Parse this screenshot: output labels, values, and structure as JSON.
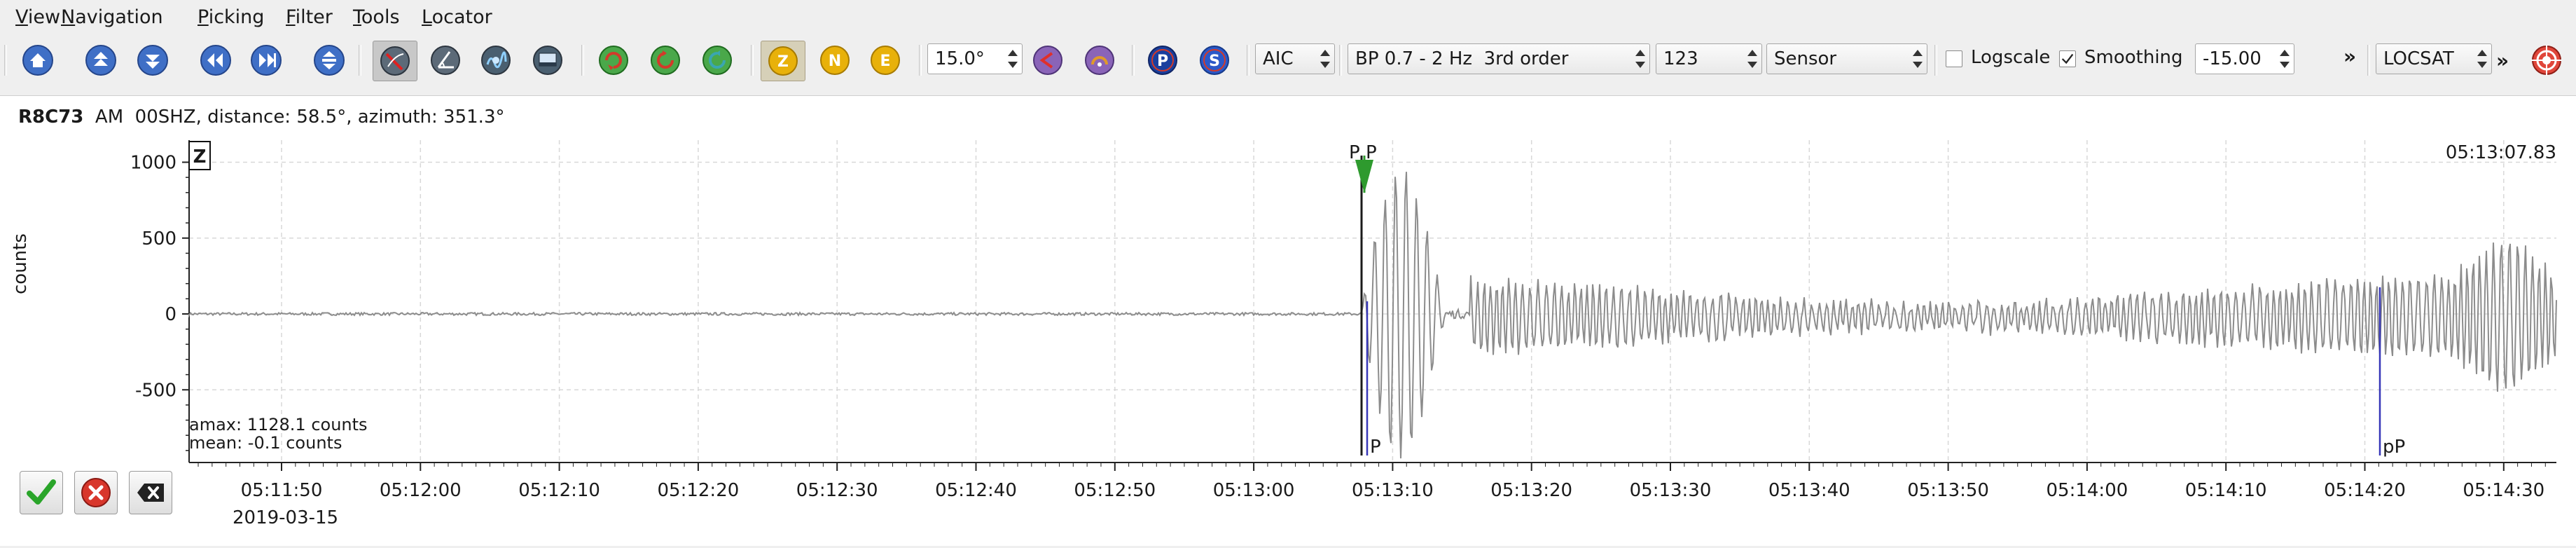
{
  "menubar": {
    "items": [
      "View",
      "Navigation",
      "Picking",
      "Filter",
      "Tools",
      "Locator"
    ]
  },
  "toolbar": {
    "nav_icons": [
      "home-icon",
      "scroll-up-icon",
      "scroll-down-icon",
      "scroll-left-icon",
      "scroll-right-icon",
      "expand-vertical-icon"
    ],
    "pick_tool_icons": [
      "pick-mode-icon",
      "slowness-icon",
      "spectrum-icon",
      "map-icon"
    ],
    "rotation_icons": [
      "rotate-green-icon",
      "rotate-red-icon",
      "rotate-teal-icon"
    ],
    "components": [
      "Z",
      "N",
      "E"
    ],
    "angle_value": "15.0°",
    "phase_buttons": [
      "P",
      "S"
    ],
    "picker_value": "AIC",
    "filter_value": "BP 0.7 - 2 Hz  3rd order",
    "number_value": "123",
    "unit_value": "Sensor",
    "logscale_label": "Logscale",
    "logscale_checked": false,
    "smoothing_label": "Smoothing",
    "smoothing_checked": true,
    "smoothing_value": "-15.00",
    "overflow_label": "»",
    "locator_value": "LOCSAT",
    "overflow_label_2": "»",
    "colors": {
      "accent_blue": "#3f6fc6",
      "component_yellow": "#e8b10a",
      "phase_p": "#1a3f9e",
      "phase_s": "#2b58c8"
    }
  },
  "trace": {
    "station": "R8C73",
    "network": "AM",
    "channel": "00SHZ",
    "info": ", distance: 58.5°, azimuth: 351.3°",
    "component_badge": "Z",
    "end_time": "05:13:07.83",
    "y_axis_label": "counts",
    "y_ticks": [
      "1000",
      "500",
      "0",
      "-500"
    ],
    "x_ticks": [
      "05:11:50",
      "05:12:00",
      "05:12:10",
      "05:12:20",
      "05:12:30",
      "05:12:40",
      "05:12:50",
      "05:13:00",
      "05:13:10",
      "05:13:20",
      "05:13:30",
      "05:13:40",
      "05:13:50",
      "05:14:00",
      "05:14:10",
      "05:14:20",
      "05:14:30"
    ],
    "date": "2019-03-15",
    "amax": "amax: 1128.1 counts",
    "mean": "mean: -0.1 counts",
    "picks": [
      {
        "label": "P",
        "kind": "manual",
        "color": "#1a1a1a"
      },
      {
        "label": "P",
        "kind": "automatic",
        "color": "#2e9a2e"
      },
      {
        "label": "P",
        "kind": "theoretical",
        "color": "#3636b8"
      },
      {
        "label": "pP",
        "kind": "theoretical",
        "color": "#3636b8"
      }
    ]
  },
  "bottom_buttons": [
    "accept-icon",
    "reject-icon",
    "delete-icon"
  ]
}
